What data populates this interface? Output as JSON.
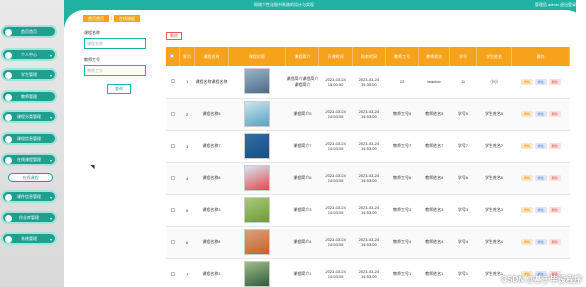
{
  "header": {
    "title": "网络个性化图书系统的设计与实现",
    "user": "管理员 admin 退出登录"
  },
  "breadcrumb": {
    "home": "首页首页",
    "current": "在线课程"
  },
  "search": {
    "label1": "课程名称",
    "placeholder1": "课程名称",
    "label2": "教师工号",
    "placeholder2": "教师工号",
    "button": "查询"
  },
  "toolbar": {
    "delete": "删除"
  },
  "table": {
    "headers": [
      "",
      "索引",
      "课程名称",
      "课程封面",
      "课程简介",
      "开课时间",
      "结束时间",
      "教师工号",
      "教师姓名",
      "学号",
      "学生姓名",
      "操作"
    ],
    "rows": [
      {
        "idx": "1",
        "name": "课程名称课程名称",
        "intro": "课程简介课程简介课程简介",
        "start": "2023-03-24 15:00:00",
        "end": "2023-03-24 15:30:00",
        "tno": "22",
        "tname": "teacher",
        "sno": "11",
        "sname": "小小"
      },
      {
        "idx": "2",
        "name": "课程名称5",
        "intro": "课程简介5",
        "start": "2023-03-24 14:53:09",
        "end": "2023-03-24 14:53:09",
        "tno": "教师工号5",
        "tname": "教师姓名5",
        "sno": "学号5",
        "sname": "学生姓名5"
      },
      {
        "idx": "3",
        "name": "课程名称7",
        "intro": "课程简介7",
        "start": "2023-03-24 14:53:09",
        "end": "2023-03-24 14:53:09",
        "tno": "教师工号7",
        "tname": "教师姓名7",
        "sno": "学号7",
        "sname": "学生姓名7"
      },
      {
        "idx": "4",
        "name": "课程名称6",
        "intro": "课程简介6",
        "start": "2023-03-24 14:53:09",
        "end": "2023-03-24 14:53:09",
        "tno": "教师工号6",
        "tname": "教师姓名6",
        "sno": "学号6",
        "sname": "学生姓名6"
      },
      {
        "idx": "5",
        "name": "课程名称3",
        "intro": "课程简介3",
        "start": "2023-03-24 14:53:09",
        "end": "2023-03-24 14:53:09",
        "tno": "教师工号3",
        "tname": "教师姓名3",
        "sno": "学号3",
        "sname": "学生姓名3"
      },
      {
        "idx": "6",
        "name": "课程名称4",
        "intro": "课程简介4",
        "start": "2023-03-24 14:53:09",
        "end": "2023-03-24 14:53:09",
        "tno": "教师工号4",
        "tname": "教师姓名4",
        "sno": "学号4",
        "sname": "学生姓名4"
      },
      {
        "idx": "7",
        "name": "课程名称1",
        "intro": "课程简介1",
        "start": "2023-03-24 14:53:09",
        "end": "2023-03-24 14:53:09",
        "tno": "教师工号1",
        "tname": "教师姓名1",
        "sno": "学号1",
        "sname": "学生姓名1"
      }
    ],
    "ops": {
      "view": "详情",
      "edit": "修改",
      "del": "删除"
    }
  },
  "sidebar": {
    "items": [
      "首页首页",
      "个人中心",
      "学生管理",
      "教师管理",
      "课程分类管理",
      "课程信息管理",
      "在线课程管理",
      "课件信息管理",
      "作业库管理",
      "系统管理"
    ],
    "submenu": "在线课程"
  },
  "watermark": "CSDN @基于毕设程序",
  "colors": {
    "accent": "#20b2a3",
    "header_row": "#f7a21b"
  }
}
